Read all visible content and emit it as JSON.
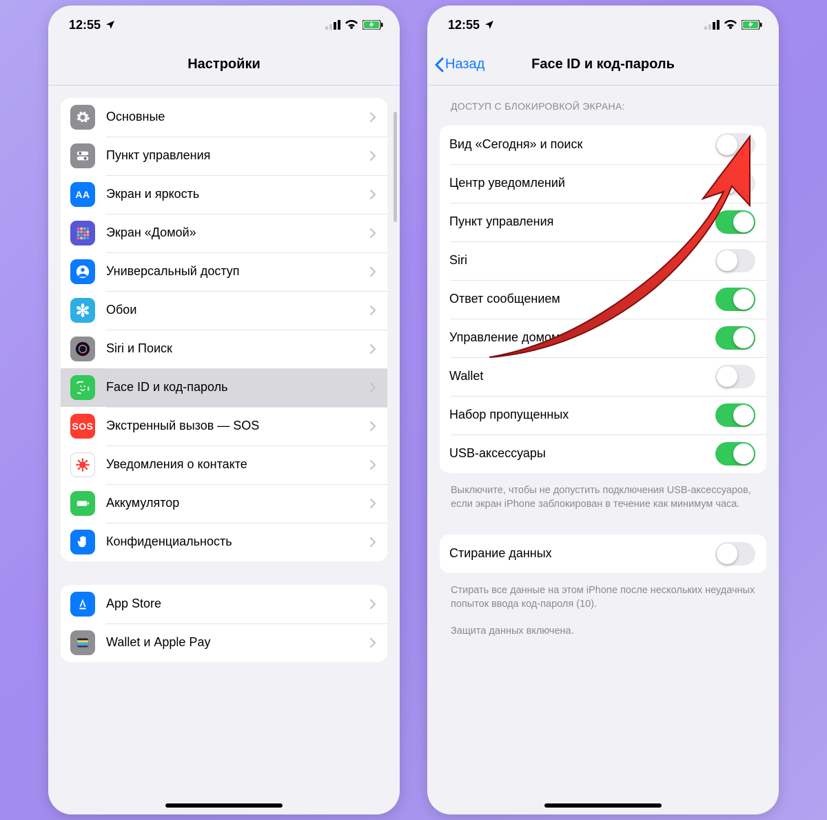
{
  "status": {
    "time": "12:55"
  },
  "left": {
    "title": "Настройки",
    "section1": [
      {
        "key": "general",
        "label": "Основные",
        "icon": "gear",
        "bg": "c-grey"
      },
      {
        "key": "control-center",
        "label": "Пункт управления",
        "icon": "sliders",
        "bg": "c-cc"
      },
      {
        "key": "display",
        "label": "Экран и яркость",
        "icon": "AA",
        "bg": "c-blue",
        "text": true
      },
      {
        "key": "home",
        "label": "Экран «Домой»",
        "icon": "grid",
        "bg": "c-pu"
      },
      {
        "key": "accessibility",
        "label": "Универсальный доступ",
        "icon": "person",
        "bg": "c-blue"
      },
      {
        "key": "wallpaper",
        "label": "Обои",
        "icon": "flower",
        "bg": "c-cy"
      },
      {
        "key": "siri",
        "label": "Siri и Поиск",
        "icon": "siri",
        "bg": "c-grey"
      },
      {
        "key": "faceid",
        "label": "Face ID и код-пароль",
        "icon": "face",
        "bg": "c-green",
        "selected": true
      },
      {
        "key": "sos",
        "label": "Экстренный вызов — SOS",
        "icon": "SOS",
        "bg": "c-red",
        "text": true
      },
      {
        "key": "exposure",
        "label": "Уведомления о контакте",
        "icon": "virus",
        "bg": "c-white"
      },
      {
        "key": "battery",
        "label": "Аккумулятор",
        "icon": "battery",
        "bg": "c-bat"
      },
      {
        "key": "privacy",
        "label": "Конфиденциальность",
        "icon": "hand",
        "bg": "c-hand"
      }
    ],
    "section2": [
      {
        "key": "appstore",
        "label": "App Store",
        "icon": "astore",
        "bg": "c-blue"
      },
      {
        "key": "wallet",
        "label": "Wallet и Apple Pay",
        "icon": "wallet",
        "bg": "c-grey"
      }
    ]
  },
  "right": {
    "back": "Назад",
    "title": "Face ID и код-пароль",
    "section_header": "ДОСТУП С БЛОКИРОВКОЙ ЭКРАНА:",
    "toggles": [
      {
        "key": "today",
        "label": "Вид «Сегодня» и поиск",
        "on": false
      },
      {
        "key": "notif",
        "label": "Центр уведомлений",
        "on": false
      },
      {
        "key": "cc",
        "label": "Пункт управления",
        "on": true
      },
      {
        "key": "siri",
        "label": "Siri",
        "on": false
      },
      {
        "key": "reply",
        "label": "Ответ сообщением",
        "on": true
      },
      {
        "key": "home",
        "label": "Управление домом",
        "on": true
      },
      {
        "key": "wallet",
        "label": "Wallet",
        "on": false
      },
      {
        "key": "missed",
        "label": "Набор пропущенных",
        "on": true
      },
      {
        "key": "usb",
        "label": "USB-аксессуары",
        "on": true
      }
    ],
    "usb_footer": "Выключите, чтобы не допустить подключения USB-аксессуаров, если экран iPhone заблокирован в течение как минимум часа.",
    "erase": {
      "label": "Стирание данных",
      "on": false
    },
    "erase_footer1": "Стирать все данные на этом iPhone после нескольких неудачных попыток ввода код-пароля (10).",
    "erase_footer2": "Защита данных включена."
  }
}
